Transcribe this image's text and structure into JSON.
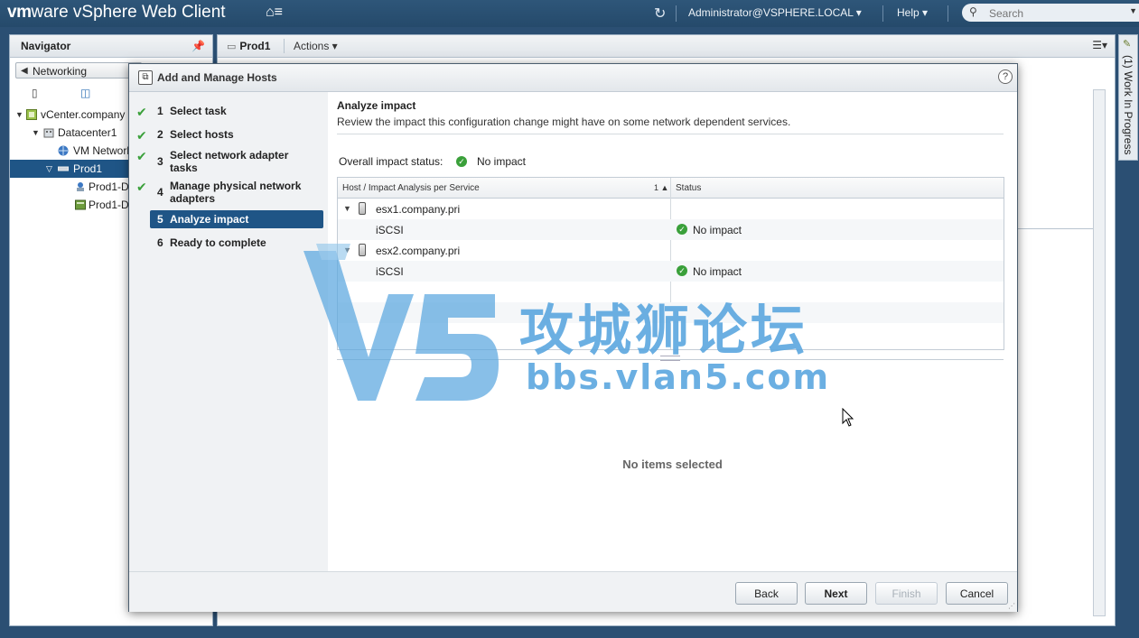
{
  "topbar": {
    "brand_vm": "vm",
    "brand_ware": "ware",
    "brand_product": " vSphere Web Client",
    "home_icon": "home-icon",
    "user": "Administrator@VSPHERE.LOCAL ▾",
    "help": "Help ▾",
    "search_placeholder": "Search"
  },
  "navigator": {
    "title": "Navigator",
    "back_label": "Networking",
    "tree": [
      {
        "label": "vCenter.company",
        "icon": "vcenter-icon",
        "level": 0,
        "expanded": true
      },
      {
        "label": "Datacenter1",
        "icon": "datacenter-icon",
        "level": 1,
        "expanded": true
      },
      {
        "label": "VM Network",
        "icon": "network-icon",
        "level": 2
      },
      {
        "label": "Prod1",
        "icon": "dvswitch-icon",
        "level": 2,
        "expanded": true,
        "selected": true
      },
      {
        "label": "Prod1-D",
        "icon": "portgroup-icon",
        "level": 3
      },
      {
        "label": "Prod1-D",
        "icon": "uplink-icon",
        "level": 3
      }
    ]
  },
  "main": {
    "title": "Prod1",
    "actions": "Actions ▾"
  },
  "work_in_progress": "(1) Work In Progress",
  "wizard": {
    "title": "Add and Manage Hosts",
    "help": "?",
    "steps": [
      {
        "num": "1",
        "label": "Select task",
        "done": true
      },
      {
        "num": "2",
        "label": "Select hosts",
        "done": true
      },
      {
        "num": "3",
        "label": "Select network adapter tasks",
        "done": true
      },
      {
        "num": "4",
        "label": "Manage physical network adapters",
        "done": true
      },
      {
        "num": "5",
        "label": "Analyze impact",
        "active": true
      },
      {
        "num": "6",
        "label": "Ready to complete"
      }
    ],
    "content": {
      "title": "Analyze impact",
      "description": "Review the impact this configuration change might have on some network dependent services.",
      "overall_label": "Overall impact status:",
      "overall_value": "No impact",
      "grid": {
        "col1": "Host / Impact Analysis per Service",
        "sort": "1 ▲",
        "col2": "Status",
        "rows": [
          {
            "type": "host",
            "label": "esx1.company.pri"
          },
          {
            "type": "service",
            "label": "iSCSI",
            "status": "No impact"
          },
          {
            "type": "host",
            "label": "esx2.company.pri"
          },
          {
            "type": "service",
            "label": "iSCSI",
            "status": "No impact"
          }
        ]
      },
      "detail_empty": "No items selected"
    },
    "buttons": {
      "back": "Back",
      "next": "Next",
      "finish": "Finish",
      "cancel": "Cancel"
    }
  },
  "watermark": {
    "logo_text": "V5",
    "chinese": "攻城狮论坛",
    "url": "bbs.vlan5.com"
  }
}
